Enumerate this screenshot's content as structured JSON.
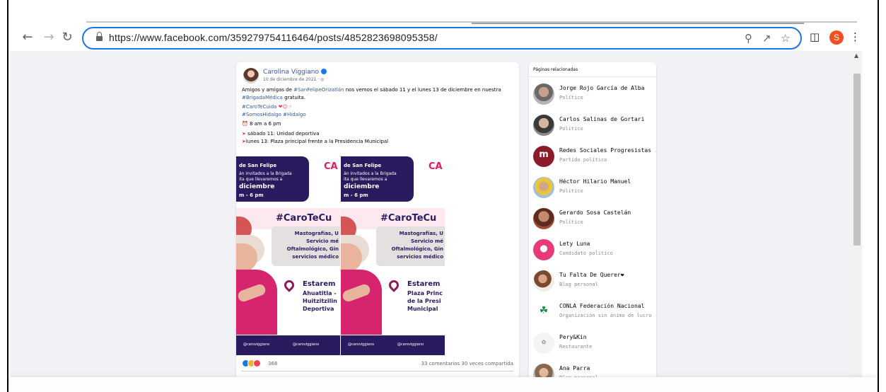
{
  "browser": {
    "url": "https://www.facebook.com/359279754116464/posts/4852823698095358/",
    "profile_initial": "S"
  },
  "post": {
    "author": "Carolina Viggiano",
    "date": "10 de diciembre de 2021 · ",
    "line1_a": "Amigos y amigas de ",
    "line1_tag": "#SanFelipeOrizatlán",
    "line1_b": " nos vemos el sábado 11 y el lunes 13 de diciembre en nuestra",
    "line2_tag": "#BrigadaMédica",
    "line2_b": " gratuita.",
    "line3_tag": "#CaroTeCuida",
    "line4_tags": "#SomosHidalgo #Hidalgo",
    "time": "8 am a 6 pm",
    "sat": "sábado 11: Unidad deportiva",
    "mon": "lunes 13: Plaza principal frente a la Presidencia Municipal",
    "reactions_count": "368",
    "stats": "33 comentarios  30 veces compartida"
  },
  "flyer": {
    "head1": "de San Felipe",
    "head2": "án invitados a la Brigada",
    "head3": "ita que llevaremos a",
    "head4": "diciembre",
    "head5": "m - 6 pm",
    "ca": "CA",
    "hashtag": "#CaroTeCu",
    "svc1": "Mastografías, U",
    "svc2": "Servicio mé",
    "svc3": "Oftalmológico, Gin",
    "svc4": "servicios médico",
    "loc1": "Estarem",
    "loc2_a": "Ahuatitla -",
    "loc2_b": "Plaza Princ",
    "loc3_a": "Huitzitzilin",
    "loc3_b": "de la Presi",
    "loc4_a": "Deportiva",
    "loc4_b": "Municipal",
    "social1": "@caroviggiano",
    "social2": "@caroviggiano"
  },
  "sidebar": {
    "title": "Páginas relacionadas",
    "items": [
      {
        "name": "Jorge Rojo García de Alba",
        "type": "Político"
      },
      {
        "name": "Carlos Salinas de Gortari",
        "type": "Político"
      },
      {
        "name": "Redes Sociales Progresistas ...",
        "type": "Partido político"
      },
      {
        "name": "Héctor Hilario Manuel",
        "type": "Político"
      },
      {
        "name": "Gerardo Sosa Castelán",
        "type": "Político"
      },
      {
        "name": "Lety Luna",
        "type": "Candidato político"
      },
      {
        "name": "Tu Falta De Querer❤",
        "type": "Blog personal"
      },
      {
        "name": "CONLA Federación Nacional",
        "type": "Organización sin ánimo de lucro"
      },
      {
        "name": "Pery&Kin",
        "type": "Restaurante"
      },
      {
        "name": "Ana Parra",
        "type": "Blog personal"
      }
    ]
  },
  "colors": {
    "accent": "#1a73e8",
    "fb_link": "#385898",
    "flyer_navy": "#2a1a5e",
    "flyer_pink": "#e6195f"
  }
}
